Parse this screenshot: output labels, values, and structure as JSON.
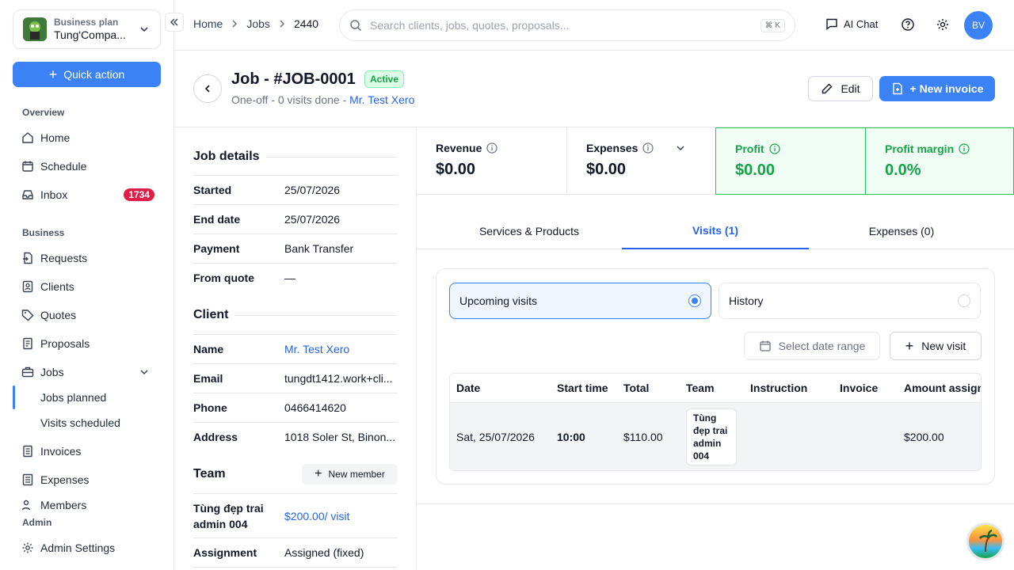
{
  "org": {
    "plan": "Business plan",
    "name": "Tung'Compa..."
  },
  "sidebar": {
    "quick_action": "Quick action",
    "overview_title": "Overview",
    "business_title": "Business",
    "admin_title": "Admin",
    "items": {
      "home": "Home",
      "schedule": "Schedule",
      "inbox": "Inbox",
      "inbox_count": "1734",
      "requests": "Requests",
      "clients": "Clients",
      "quotes": "Quotes",
      "proposals": "Proposals",
      "jobs": "Jobs",
      "jobs_planned": "Jobs planned",
      "visits_scheduled": "Visits scheduled",
      "invoices": "Invoices",
      "expenses": "Expenses",
      "members": "Members",
      "admin_settings": "Admin Settings"
    }
  },
  "header": {
    "breadcrumb": [
      "Home",
      "Jobs",
      "2440"
    ],
    "search_placeholder": "Search clients, jobs, quotes, proposals...",
    "search_shortcut": "⌘ K",
    "ai_chat": "AI Chat",
    "avatar_initials": "BV"
  },
  "job": {
    "title": "Job - #JOB-0001",
    "status": "Active",
    "subtitle": "One-off - 0 visits done - ",
    "client_link": "Mr. Test Xero",
    "edit": "Edit",
    "new_invoice": "+ New invoice"
  },
  "details": {
    "job_details_title": "Job details",
    "started_label": "Started",
    "started": "25/07/2026",
    "end_label": "End date",
    "end": "25/07/2026",
    "payment_label": "Payment",
    "payment": "Bank Transfer",
    "quote_label": "From quote",
    "quote": "—",
    "client_title": "Client",
    "name_label": "Name",
    "name": "Mr. Test Xero",
    "email_label": "Email",
    "email": "tungdt1412.work+cli...",
    "phone_label": "Phone",
    "phone": "0466414620",
    "address_label": "Address",
    "address": "1018 Soler St, Binon...",
    "team_title": "Team",
    "new_member": "New member",
    "member_name": "Tùng đẹp trai admin 004",
    "member_rate": "$200.00/ visit",
    "assignment_label": "Assignment",
    "assignment": "Assigned (fixed)"
  },
  "stats": {
    "revenue_label": "Revenue",
    "revenue": "$0.00",
    "expenses_label": "Expenses",
    "expenses": "$0.00",
    "profit_label": "Profit",
    "profit": "$0.00",
    "margin_label": "Profit margin",
    "margin": "0.0%"
  },
  "tabs": {
    "services": "Services & Products",
    "visits": "Visits (1)",
    "expenses": "Expenses (0)"
  },
  "visits": {
    "upcoming": "Upcoming visits",
    "history": "History",
    "date_range": "Select date range",
    "new_visit": "New visit",
    "columns": [
      "Date",
      "Start time",
      "Total",
      "Team",
      "Instruction",
      "Invoice",
      "Amount assign"
    ],
    "row": {
      "date": "Sat, 25/07/2026",
      "start": "10:00",
      "total": "$110.00",
      "team": "Tùng đẹp trai admin 004",
      "instruction": "",
      "invoice": "",
      "amount": "$200.00"
    }
  },
  "colors": {
    "accent": "#3b82f6",
    "success": "#16a34a",
    "danger": "#e11d48"
  }
}
